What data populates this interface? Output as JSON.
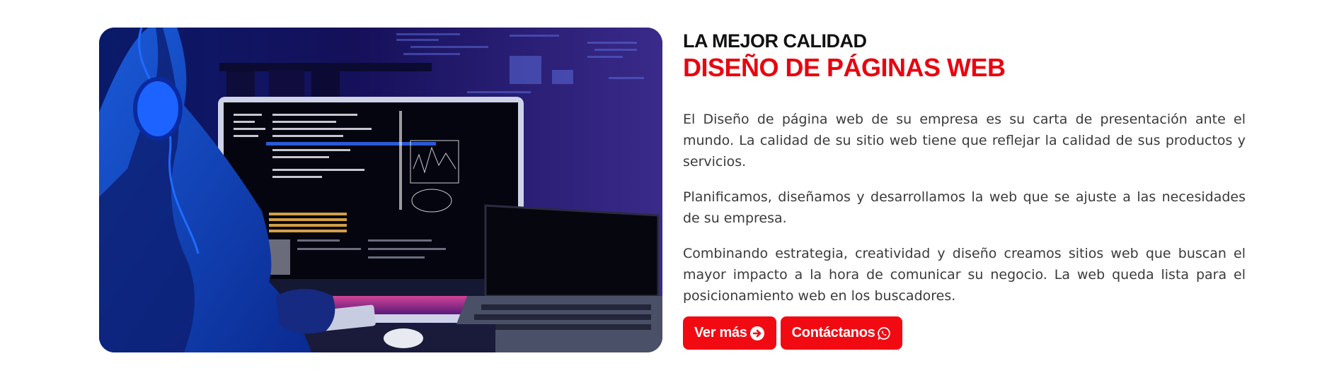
{
  "hero": {
    "subtitle": "LA MEJOR CALIDAD",
    "title": "DISEÑO DE PÁGINAS WEB",
    "paragraphs": [
      "El Diseño de página web de su empresa es su carta de presentación ante el mundo. La calidad de su sitio web tiene que reflejar la calidad de sus productos y servicios.",
      "Planificamos, diseñamos y desarrollamos la web que se ajuste a las necesidades de su empresa.",
      "Combinando estrategia, creatividad y diseño creamos sitios web que buscan el mayor impacto a la hora de comunicar su negocio. La web queda lista para el posicionamiento web en los buscadores."
    ],
    "buttons": {
      "more_label": "Ver más",
      "more_icon": "arrow-circle-right-icon",
      "contact_label": "Contáctanos",
      "contact_icon": "whatsapp-icon"
    }
  },
  "colors": {
    "accent": "#f20a12",
    "title_red": "#e8050f",
    "heading": "#111111",
    "body_text": "#3a3a3a"
  }
}
